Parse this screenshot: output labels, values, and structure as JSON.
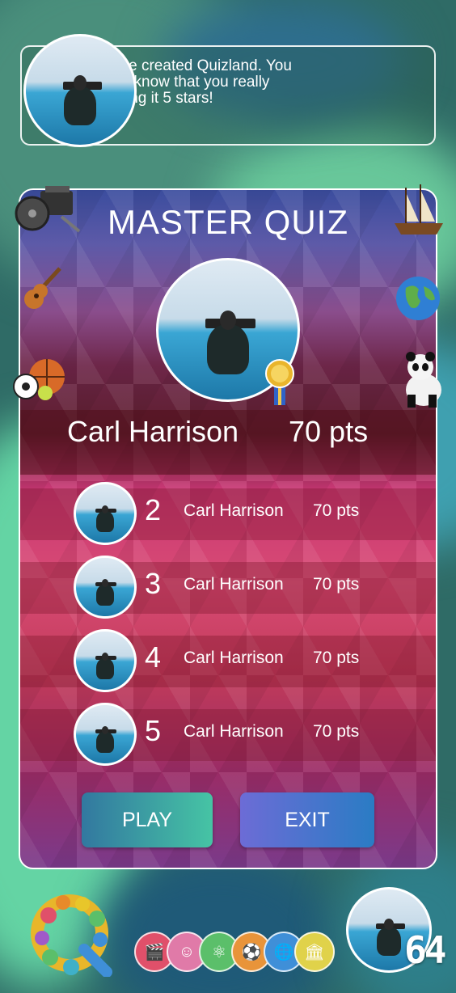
{
  "info": {
    "message": "This is Carl, he created Quizland. You should let him know that you really liked it by giviing it 5 stars!"
  },
  "panel": {
    "title": "MASTER QUIZ",
    "leader": {
      "name": "Carl Harrison",
      "points": "70 pts"
    },
    "rows": [
      {
        "rank": "2",
        "name": "Carl Harrison",
        "points": "70 pts"
      },
      {
        "rank": "3",
        "name": "Carl Harrison",
        "points": "70 pts"
      },
      {
        "rank": "4",
        "name": "Carl Harrison",
        "points": "70 pts"
      },
      {
        "rank": "5",
        "name": "Carl Harrison",
        "points": "70 pts"
      }
    ],
    "play_label": "PLAY",
    "exit_label": "EXIT"
  },
  "decorations": [
    "film-reel-icon",
    "ship-icon",
    "guitar-icon",
    "globe-icon",
    "sports-balls-icon",
    "panda-icon"
  ],
  "bottom": {
    "score": "64",
    "category_icons": [
      "movies-icon",
      "people-icon",
      "science-icon",
      "sports-icon",
      "geography-icon",
      "history-icon"
    ],
    "category_colors": [
      "#e0506a",
      "#e07aa8",
      "#5bbf6a",
      "#e8943a",
      "#3f8fd8",
      "#e0d24a"
    ]
  }
}
